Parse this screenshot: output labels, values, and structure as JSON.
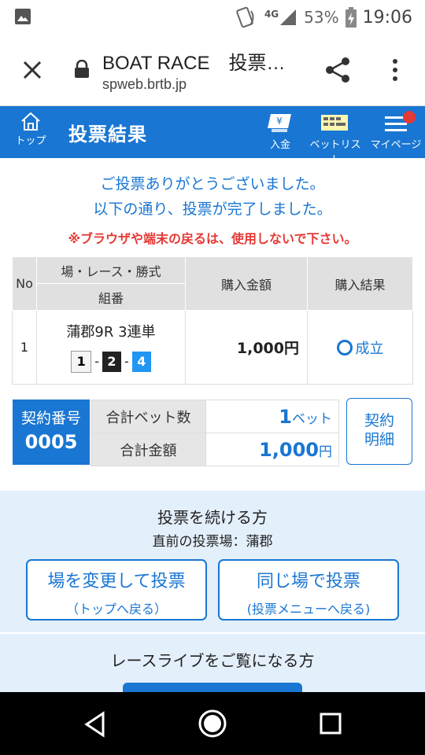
{
  "status_bar": {
    "network": "4G",
    "battery": "53%",
    "time": "19:06"
  },
  "browser": {
    "title": "BOAT RACE　投票…",
    "url": "spweb.brtb.jp"
  },
  "nav": {
    "top_label": "トップ",
    "page_title": "投票結果",
    "deposit_label": "入金",
    "betlist_label": "ベットリスト",
    "mypage_label": "マイページ"
  },
  "messages": {
    "line1": "ご投票ありがとうございました。",
    "line2": "以下の通り、投票が完了しました。",
    "warning": "※ブラウザや端末の戻るは、使用しないで下さい。"
  },
  "table": {
    "headers": {
      "no": "No",
      "race_top": "場・レース・勝式",
      "race_bottom": "組番",
      "amount": "購入金額",
      "result": "購入結果"
    },
    "rows": [
      {
        "no": "1",
        "race": "蒲郡9R 3連単",
        "combo": [
          "1",
          "2",
          "4"
        ],
        "sep": "-",
        "amount": "1,000円",
        "result": "成立"
      }
    ]
  },
  "summary": {
    "contract_label": "契約番号",
    "contract_number": "0005",
    "bet_count_label": "合計ベット数",
    "bet_count": "1",
    "bet_unit": "ベット",
    "total_label": "合計金額",
    "total_amount": "1,000",
    "total_unit": "円",
    "detail_line1": "契約",
    "detail_line2": "明細"
  },
  "continue": {
    "title": "投票を続ける方",
    "prev_venue": "直前の投票場：蒲郡",
    "btn_change_main": "場を変更して投票",
    "btn_change_sub": "（トップへ戻る）",
    "btn_same_main": "同じ場で投票",
    "btn_same_sub": "(投票メニューへ戻る)"
  },
  "live": {
    "title": "レースライブをご覧になる方"
  },
  "colors": {
    "primary": "#1976d2",
    "warning": "#e53935",
    "section_bg": "#e3effb"
  }
}
